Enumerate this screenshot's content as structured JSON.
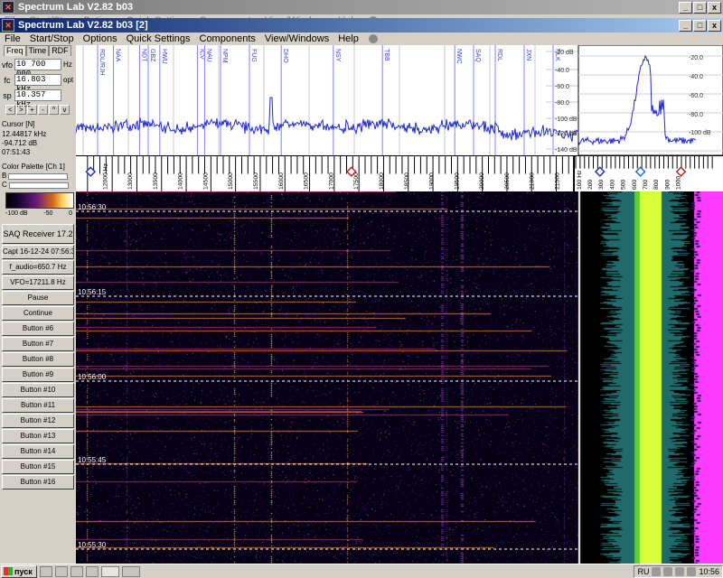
{
  "outer_window": {
    "title": "Spectrum Lab V2.82 b03",
    "menu": [
      "File",
      "Start/Stop",
      "Options",
      "Quick Settings",
      "Components",
      "View/Windows",
      "Help"
    ]
  },
  "inner_window": {
    "title": "Spectrum Lab V2.82 b03 [2]",
    "menu": [
      "File",
      "Start/Stop",
      "Options",
      "Quick Settings",
      "Components",
      "View/Windows",
      "Help"
    ]
  },
  "freq_panel": {
    "tabs": [
      "Freq",
      "Time",
      "RDF"
    ],
    "vfo": {
      "label": "vfo",
      "value": "10 700 000",
      "unit": "Hz"
    },
    "fc": {
      "label": "fc",
      "value": "16.803 kHz",
      "unit": "opt"
    },
    "sp": {
      "label": "sp",
      "value": "10.357 kHz",
      "unit": ""
    },
    "nav_buttons": [
      "<",
      ">",
      "+",
      "-",
      "^",
      "v"
    ]
  },
  "cursor": {
    "header": "Cursor [N]",
    "freq": "12.44817 kHz",
    "level": "-94.712 dB",
    "time": "07:51:43"
  },
  "color_palette": {
    "header": "Color Palette [Ch 1]",
    "b": "B",
    "c": "C",
    "labels": [
      "-100 dB",
      "-50",
      "0"
    ]
  },
  "buttons": [
    "SAQ Receiver 17.2",
    "Capt 16-12-24 07:56:33",
    "f_audio=650.7 Hz",
    "VFO=17211.8 Hz",
    "Pause",
    "Continue",
    "Button #6",
    "Button #7",
    "Button #8",
    "Button #9",
    "Button #10",
    "Button #11",
    "Button #12",
    "Button #13",
    "Button #14",
    "Button #15",
    "Button #16"
  ],
  "spectrum_db_labels": [
    "-20 dB",
    "-40.0",
    "-60.0",
    "-80.0",
    "-100 dB",
    "-120 dB",
    "-140 dB"
  ],
  "zoom_db_labels": [
    "-20.0",
    "-40.0",
    "-60.0",
    "-80.0",
    "-100 dB"
  ],
  "freq_ticks": [
    "12000 Hz",
    "13000",
    "13500",
    "14000",
    "14500",
    "15000",
    "15500",
    "16000",
    "16500",
    "17000",
    "17500",
    "18000",
    "18500",
    "19000",
    "19500",
    "20000",
    "20500",
    "21000",
    "21500"
  ],
  "zoom_freq_ticks": [
    "100 Hz",
    "200",
    "300",
    "400",
    "500",
    "600",
    "700",
    "800",
    "900",
    "1000"
  ],
  "station_markers": [
    "RDL/RJH",
    "NAA",
    "NDT",
    "GBZ",
    "HWU",
    "ICV",
    "NAU",
    "NPM",
    "FUG",
    "DHO",
    "NSY",
    "TBB",
    "NWC",
    "SAQ",
    "RDL",
    "JXN",
    "NLK"
  ],
  "time_labels": [
    "10:56:30",
    "10:56:15",
    "10:56:00",
    "10:55:45",
    "10:55:30"
  ],
  "taskbar": {
    "start": "пуск",
    "lang": "RU",
    "clock": "10:56"
  },
  "colors": {
    "spectrum_line": "#1f2bd0",
    "marker_line": "#8080ff",
    "waterfall_bg": "#050015",
    "signal_hot": "#ffd86a",
    "zoom_signal": "#d6ff3a",
    "right_strip": "#ff3cff",
    "title_active": "#0a246a"
  }
}
